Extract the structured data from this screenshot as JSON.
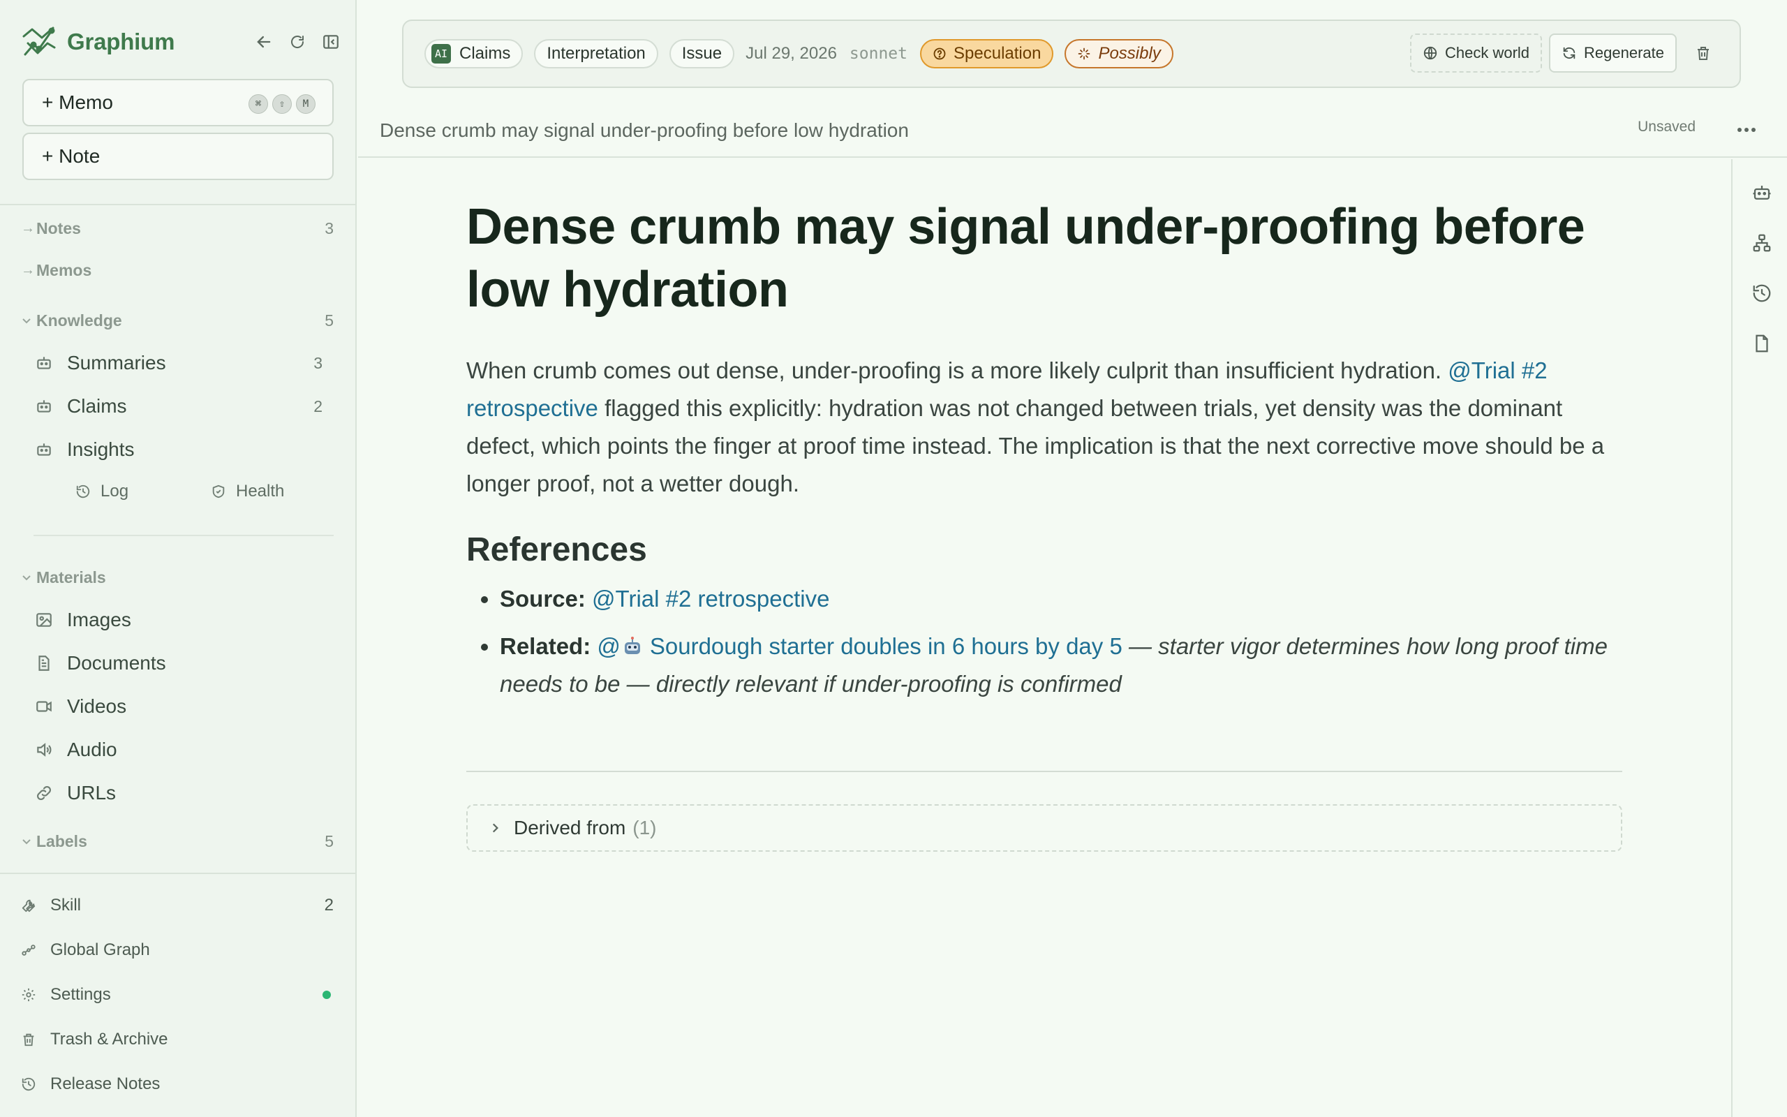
{
  "app": {
    "name": "Graphium"
  },
  "sidebar": {
    "memo_button": "+ Memo",
    "memo_shortcut": [
      "⌘",
      "⇧",
      "M"
    ],
    "note_button": "+ Note",
    "sections": {
      "notes": {
        "label": "Notes",
        "count": "3"
      },
      "memos": {
        "label": "Memos"
      },
      "knowledge": {
        "label": "Knowledge",
        "count": "5"
      },
      "materials": {
        "label": "Materials"
      },
      "labels": {
        "label": "Labels",
        "count": "5"
      }
    },
    "knowledge_items": [
      {
        "label": "Summaries",
        "count": "3",
        "icon": "robot-icon"
      },
      {
        "label": "Claims",
        "count": "2",
        "icon": "robot-icon"
      },
      {
        "label": "Insights",
        "icon": "robot-icon"
      }
    ],
    "mini_links": {
      "log": "Log",
      "health": "Health"
    },
    "materials_items": [
      {
        "label": "Images",
        "icon": "image-icon"
      },
      {
        "label": "Documents",
        "icon": "document-icon"
      },
      {
        "label": "Videos",
        "icon": "video-icon"
      },
      {
        "label": "Audio",
        "icon": "speaker-icon"
      },
      {
        "label": "URLs",
        "icon": "link-icon"
      }
    ],
    "footer": {
      "skill": {
        "label": "Skill",
        "count": "2"
      },
      "global_graph": "Global Graph",
      "settings": "Settings",
      "trash_archive": "Trash & Archive",
      "release_notes": "Release Notes"
    }
  },
  "toolbar": {
    "ai_badge": "AI",
    "chips": [
      "Claims",
      "Interpretation",
      "Issue"
    ],
    "date": "Jul 29, 2026",
    "model": "sonnet",
    "speculation": "Speculation",
    "possibly": "Possibly",
    "check_world": "Check world",
    "regenerate": "Regenerate"
  },
  "subheader": {
    "title": "Dense crumb may signal under-proofing before low hydration",
    "status": "Unsaved"
  },
  "document": {
    "title": "Dense crumb may signal under-proofing before low hydration",
    "para_before": "When crumb comes out dense, under-proofing is a more likely culprit than insufficient hydration. ",
    "para_link": "@Trial #2 retrospective",
    "para_after": " flagged this explicitly: hydration was not changed between trials, yet density was the dominant defect, which points the finger at proof time instead. The implication is that the next corrective move should be a longer proof, not a wetter dough.",
    "references_heading": "References",
    "source_label": "Source:",
    "source_link": "@Trial #2 retrospective",
    "related_label": "Related:",
    "related_at": "@",
    "related_link": "Sourdough starter doubles in 6 hours by day 5",
    "related_note": " — starter vigor determines how long proof time needs to be — directly relevant if under-proofing is confirmed",
    "derived_label": "Derived from",
    "derived_count": "(1)"
  },
  "colors": {
    "accent": "#3f7a4c",
    "link": "#1f6f93",
    "speculation": "#f9d89f",
    "possibly_border": "#c6762b",
    "status_dot": "#2bb673"
  }
}
